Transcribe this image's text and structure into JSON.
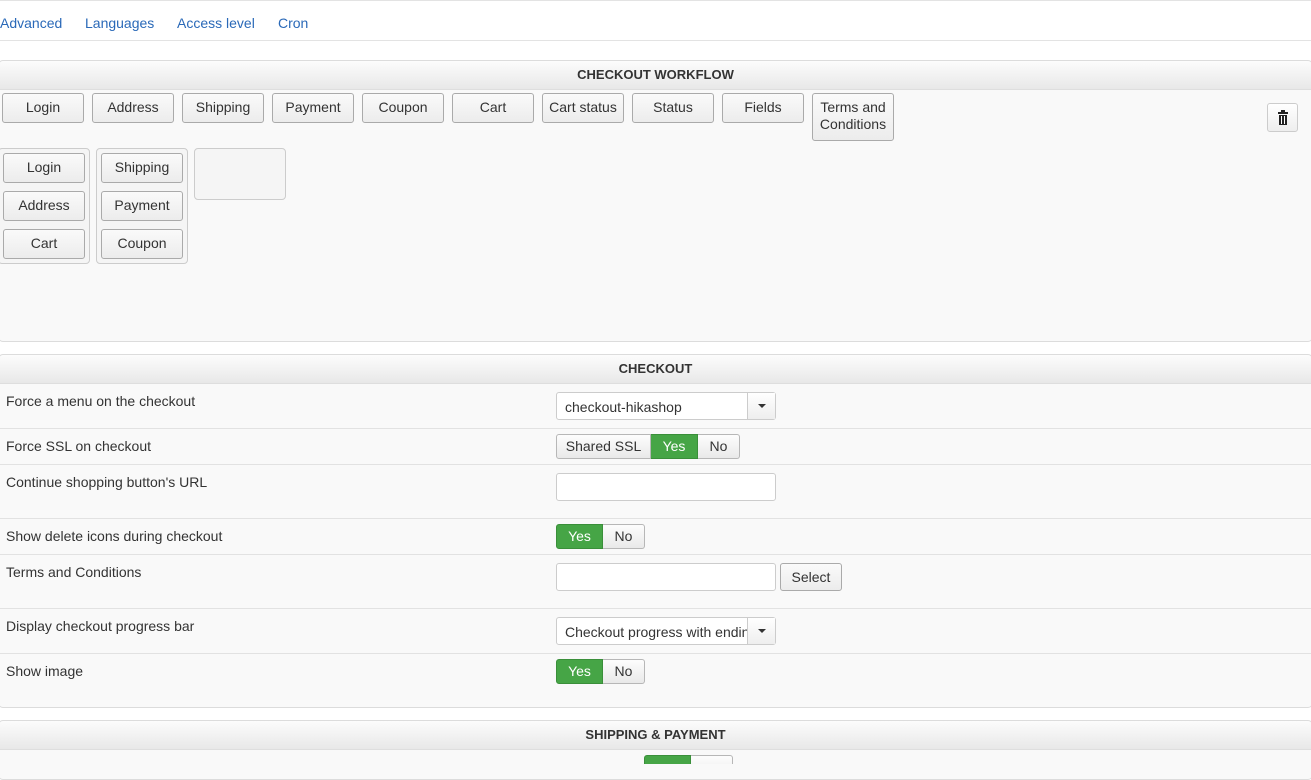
{
  "tabs": [
    "Advanced",
    "Languages",
    "Access level",
    "Cron"
  ],
  "workflow": {
    "title": "CHECKOUT WORKFLOW",
    "available": [
      "Login",
      "Address",
      "Shipping",
      "Payment",
      "Coupon",
      "Cart",
      "Cart status",
      "Status",
      "Fields",
      "Terms and Conditions"
    ],
    "steps": [
      [
        "Login",
        "Address",
        "Cart"
      ],
      [
        "Shipping",
        "Payment",
        "Coupon"
      ],
      []
    ],
    "delete_icon": "trash-icon"
  },
  "checkout": {
    "title": "CHECKOUT",
    "rows": {
      "force_menu": {
        "label": "Force a menu on the checkout",
        "value": "checkout-hikashop"
      },
      "force_ssl": {
        "label": "Force SSL on checkout",
        "options": [
          "Shared SSL",
          "Yes",
          "No"
        ],
        "selected": "Yes"
      },
      "continue_url": {
        "label": "Continue shopping button's URL",
        "value": ""
      },
      "delete_icons": {
        "label": "Show delete icons during checkout",
        "options": [
          "Yes",
          "No"
        ],
        "selected": "Yes"
      },
      "terms": {
        "label": "Terms and Conditions",
        "value": "",
        "button": "Select"
      },
      "progress_bar": {
        "label": "Display checkout progress bar",
        "value": "Checkout progress with ending"
      },
      "show_image": {
        "label": "Show image",
        "options": [
          "Yes",
          "No"
        ],
        "selected": "Yes"
      }
    }
  },
  "shipping_payment": {
    "title": "SHIPPING & PAYMENT"
  },
  "colors": {
    "accent": "#46a546",
    "link": "#2a69b8"
  }
}
